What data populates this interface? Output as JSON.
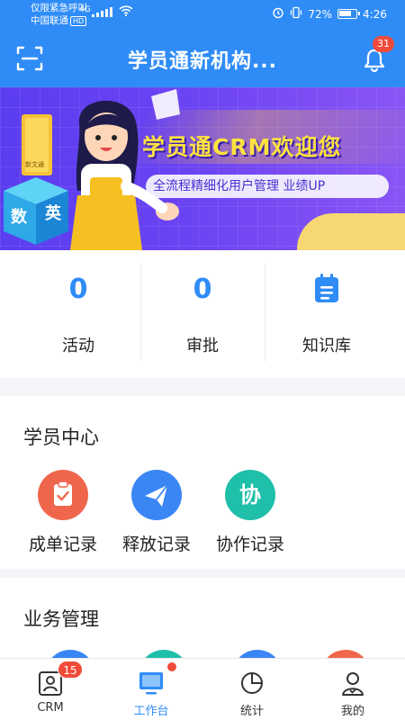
{
  "status_bar": {
    "line1": "仅限紧急呼叫",
    "line2": "中国联通",
    "hd": "HD",
    "net": "4G",
    "battery": "72%",
    "time": "4:26"
  },
  "header": {
    "title": "学员通新机构...",
    "notification_count": "31"
  },
  "banner": {
    "title": "学员通CRM欢迎您",
    "subtitle": "全流程精细化用户管理  业绩UP",
    "cube_chars": [
      "数",
      "英"
    ],
    "book_label": "新文通"
  },
  "stats": [
    {
      "value": "0",
      "label": "活动"
    },
    {
      "value": "0",
      "label": "审批"
    },
    {
      "label": "知识库",
      "icon": "document-list-icon"
    }
  ],
  "student_center": {
    "title": "学员中心",
    "apps": [
      {
        "label": "成单记录",
        "icon": "clipboard-check-icon",
        "color": "#f0664c"
      },
      {
        "label": "释放记录",
        "icon": "paper-plane-icon",
        "color": "#3a86f5"
      },
      {
        "label": "协作记录",
        "icon_text": "协",
        "color": "#1fbfa9"
      }
    ]
  },
  "business": {
    "title": "业务管理",
    "icon_colors": [
      "#3a86f5",
      "#1fbfa9",
      "#3a86f5",
      "#f0664c"
    ]
  },
  "tabbar": {
    "tabs": [
      {
        "label": "CRM",
        "badge": "15",
        "icon": "contact-card-icon"
      },
      {
        "label": "工作台",
        "icon": "monitor-icon"
      },
      {
        "label": "统计",
        "icon": "pie-chart-icon"
      },
      {
        "label": "我的",
        "icon": "user-icon"
      }
    ]
  }
}
